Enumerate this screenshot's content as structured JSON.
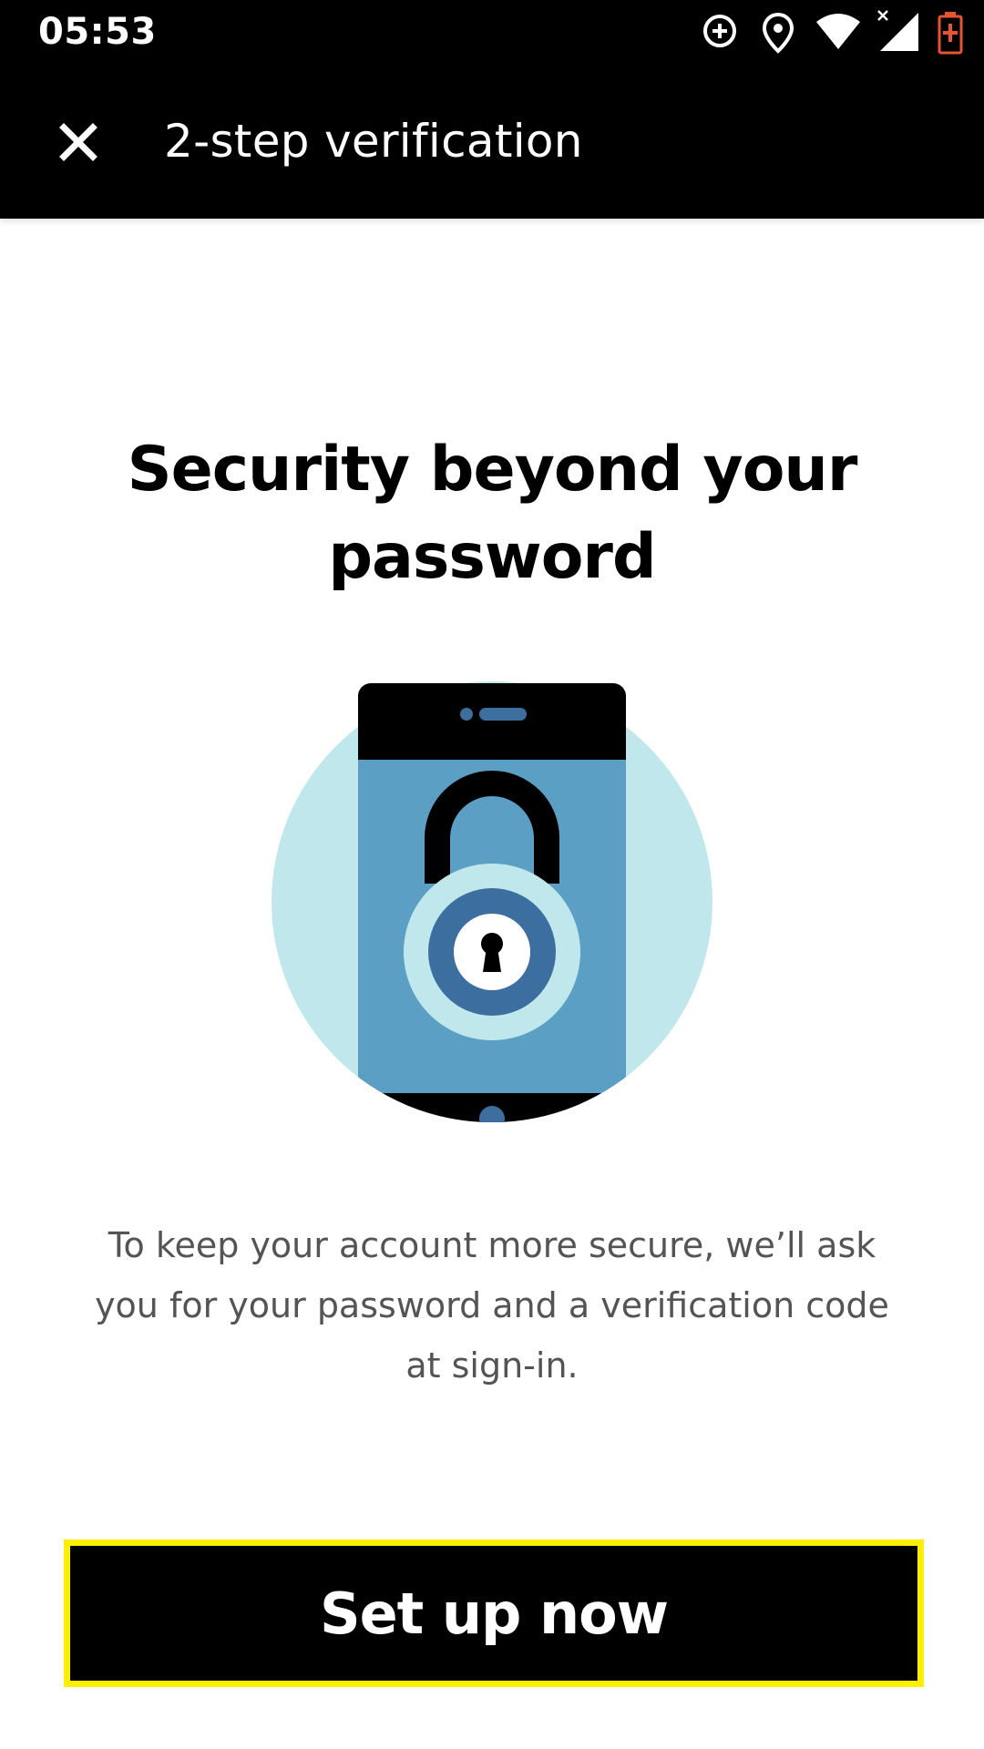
{
  "status_bar": {
    "time": "05:53",
    "icons": [
      "data-saver-icon",
      "location-icon",
      "wifi-icon",
      "cellular-signal-icon",
      "battery-low-icon"
    ],
    "battery_color": "#e8542f"
  },
  "app_bar": {
    "title": "2-step verification",
    "close_icon": "close-icon"
  },
  "content": {
    "headline": "Security beyond your password",
    "illustration": "phone-padlock-illustration",
    "description": "To keep your account more secure, we’ll ask you for your password and a verification code at sign-in."
  },
  "actions": {
    "primary_label": "Set up now",
    "primary_focus_color": "#ffee00"
  },
  "colors": {
    "bar_background": "#000000",
    "circle": "#c0e8ec",
    "screen": "#5b9fc5",
    "lock_ring": "#3c6e9f"
  }
}
